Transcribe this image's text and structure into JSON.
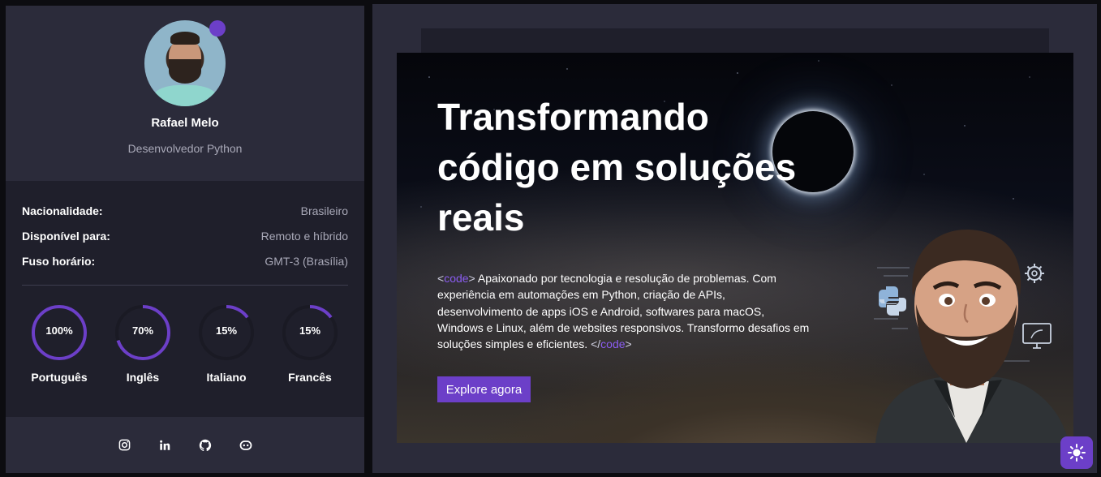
{
  "profile": {
    "name": "Rafael Melo",
    "role": "Desenvolvedor Python",
    "online_color": "#6c3fc8"
  },
  "details": [
    {
      "label": "Nacionalidade:",
      "value": "Brasileiro"
    },
    {
      "label": "Disponível para:",
      "value": "Remoto e híbrido"
    },
    {
      "label": "Fuso horário:",
      "value": "GMT-3 (Brasília)"
    }
  ],
  "languages": [
    {
      "name": "Português",
      "percent_label": "100%",
      "percent": 100
    },
    {
      "name": "Inglês",
      "percent_label": "70%",
      "percent": 70
    },
    {
      "name": "Italiano",
      "percent_label": "15%",
      "percent": 15
    },
    {
      "name": "Francês",
      "percent_label": "15%",
      "percent": 15
    }
  ],
  "socials": [
    {
      "icon": "instagram-icon"
    },
    {
      "icon": "linkedin-icon"
    },
    {
      "icon": "github-icon"
    },
    {
      "icon": "discord-icon"
    }
  ],
  "hero": {
    "title": "Transformando código em soluções reais",
    "code_open_bracket": "<",
    "code_open_tag": "code",
    "code_open_close": ">",
    "description": " Apaixonado por tecnologia e resolução de problemas. Com experiência em automações em Python, criação de APIs, desenvolvimento de apps iOS e Android, softwares para macOS, Windows e Linux, além de websites responsivos. Transformo desafios em soluções simples e eficientes. ",
    "code_close_bracket": "</",
    "code_close_tag": "code",
    "code_close_close": ">",
    "cta_label": "Explore agora"
  },
  "colors": {
    "accent": "#6c3fc8",
    "panel": "#2b2b3a",
    "panel_dark": "#1f1f2b",
    "muted_text": "#a9a9b8"
  },
  "theme_toggle": {
    "icon": "sun-icon"
  }
}
